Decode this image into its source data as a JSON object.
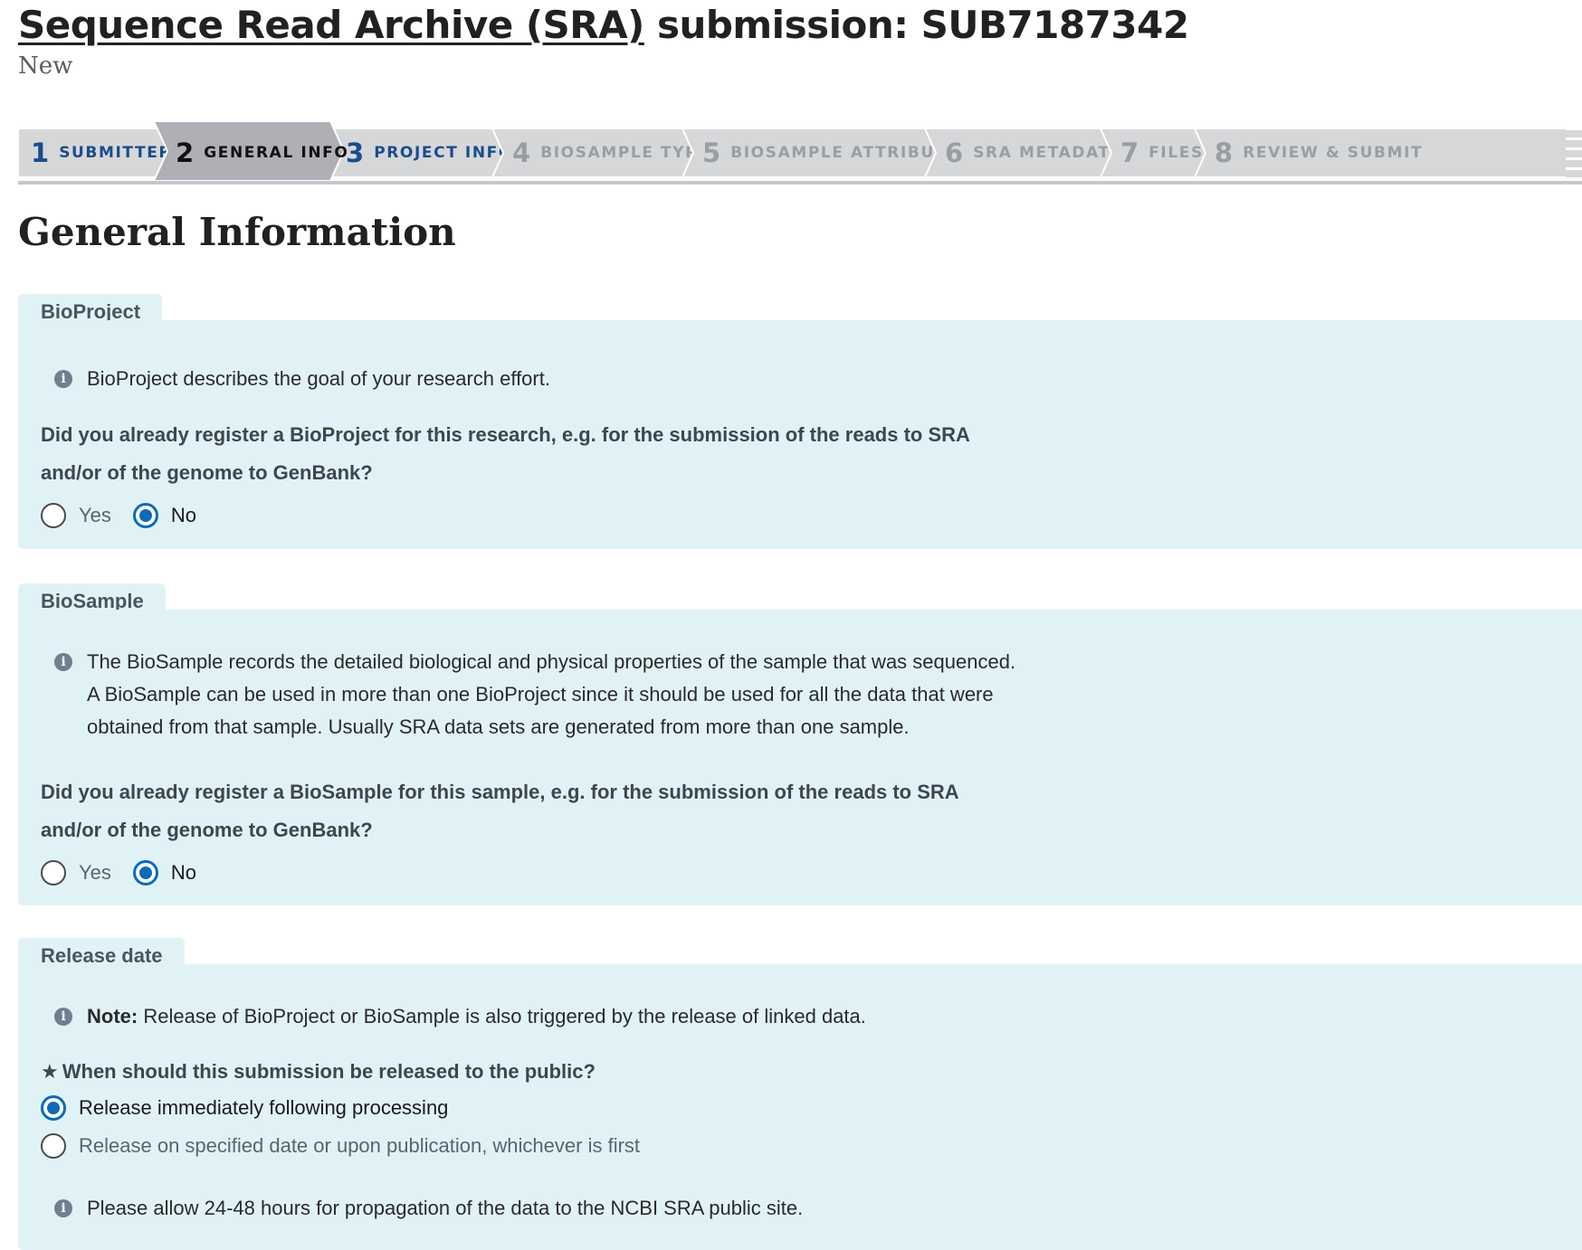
{
  "header": {
    "title_link": "Sequence Read Archive (SRA)",
    "title_rest": " submission: SUB7187342",
    "status": "New"
  },
  "steps": [
    {
      "num": "1",
      "label": "Submitter",
      "state": "done"
    },
    {
      "num": "2",
      "label": "General Info",
      "state": "active"
    },
    {
      "num": "3",
      "label": "Project Info",
      "state": "done"
    },
    {
      "num": "4",
      "label": "BioSample Type",
      "state": "todo"
    },
    {
      "num": "5",
      "label": "BioSample Attributes",
      "state": "todo"
    },
    {
      "num": "6",
      "label": "SRA Metadata",
      "state": "todo"
    },
    {
      "num": "7",
      "label": "Files",
      "state": "todo"
    },
    {
      "num": "8",
      "label": "Review & Submit",
      "state": "todo"
    }
  ],
  "section_title": "General Information",
  "bioproject": {
    "legend": "BioProject",
    "info": "BioProject describes the goal of your research effort.",
    "question_line1": "Did you already register a BioProject for this research, e.g. for the submission of the reads to SRA",
    "question_line2": "and/or of the genome to GenBank?",
    "options": [
      "Yes",
      "No"
    ],
    "selected": "No"
  },
  "biosample": {
    "legend": "BioSample",
    "info_line1": "The BioSample records the detailed biological and physical properties of the sample that was sequenced.",
    "info_line2": "A BioSample can be used in more than one BioProject since it should be used for all the data that were",
    "info_line3": "obtained from that sample. Usually SRA data sets are generated from more than one sample.",
    "question_line1": "Did you already register a BioSample for this sample, e.g. for the submission of the reads to SRA",
    "question_line2": "and/or of the genome to GenBank?",
    "options": [
      "Yes",
      "No"
    ],
    "selected": "No"
  },
  "release": {
    "legend": "Release date",
    "note_label": "Note:",
    "note_text": " Release of BioProject or BioSample is also triggered by the release of linked data.",
    "required_marker": "★",
    "question": "When should this submission be released to the public?",
    "options": [
      "Release immediately following processing",
      "Release on specified date or upon publication, whichever is first"
    ],
    "selected": "Release immediately following processing",
    "footer_info": "Please allow 24-48 hours for propagation of the data to the NCBI SRA public site."
  },
  "colors": {
    "panel_bg": "#e1f2f7",
    "step_done": "#1a4d8c",
    "step_active_bg": "#aeb0b5",
    "step_bg": "#d6d7d9",
    "radio_selected": "#0b6bb8"
  }
}
